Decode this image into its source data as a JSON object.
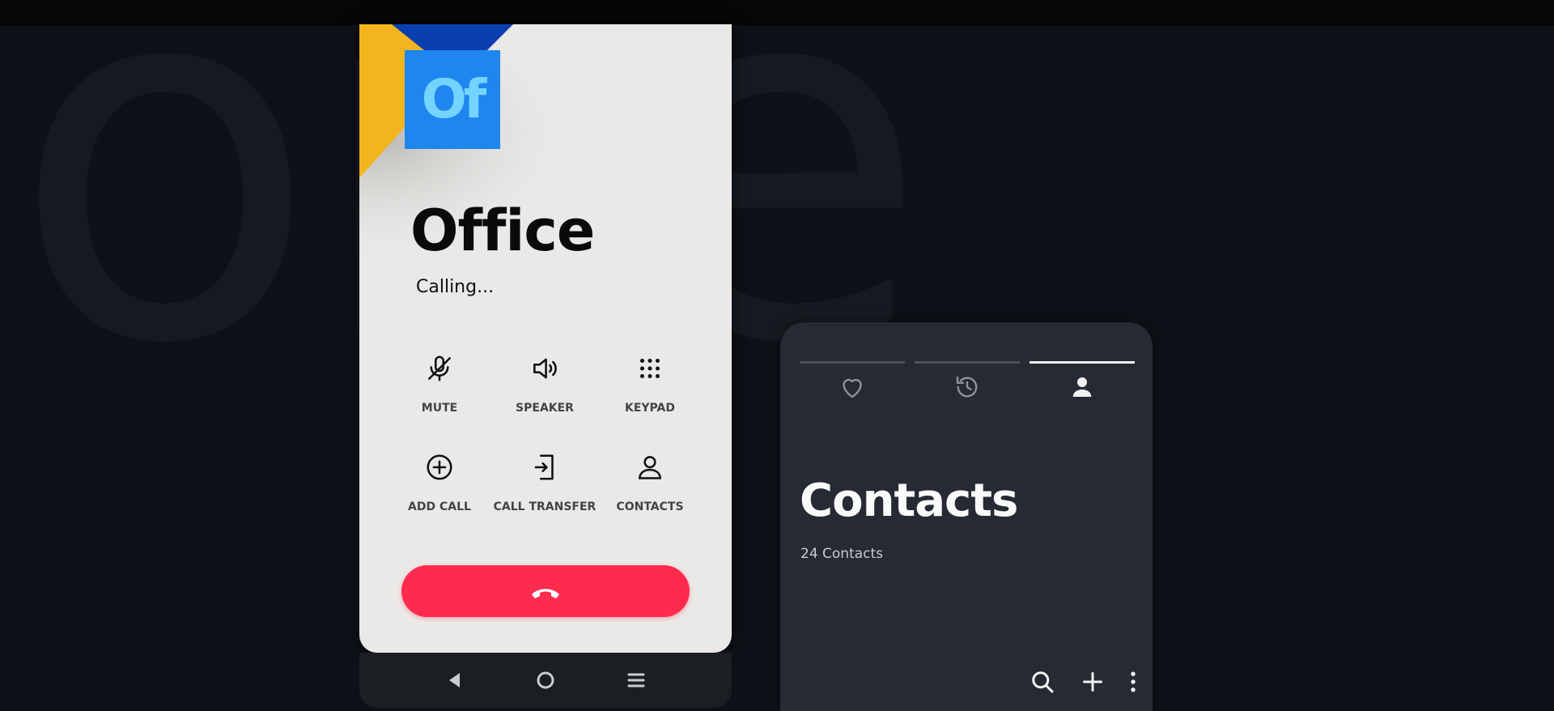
{
  "background": {
    "watermark_text": "one",
    "color": "#0e1117"
  },
  "call_screen": {
    "avatar_initials": "Of",
    "caller_name": "Office",
    "status": "Calling...",
    "actions": [
      {
        "label": "MUTE",
        "icon": "mic-off-icon"
      },
      {
        "label": "SPEAKER",
        "icon": "speaker-icon"
      },
      {
        "label": "KEYPAD",
        "icon": "keypad-icon"
      },
      {
        "label": "ADD CALL",
        "icon": "add-call-icon"
      },
      {
        "label": "CALL TRANSFER",
        "icon": "call-transfer-icon"
      },
      {
        "label": "CONTACTS",
        "icon": "contacts-icon"
      }
    ],
    "end_call_icon": "phone-hangup-icon",
    "colors": {
      "end_call": "#ff2b4f",
      "tile": "#1f86f0",
      "tile_text": "#74d4ff",
      "accent_yellow": "#f3b51e",
      "accent_blue": "#0a3fb0"
    }
  },
  "nav_bar": {
    "buttons": [
      "back-icon",
      "home-icon",
      "recents-icon"
    ]
  },
  "contacts_screen": {
    "tabs": [
      {
        "name": "favorites",
        "icon": "heart-icon",
        "active": false
      },
      {
        "name": "recents",
        "icon": "history-icon",
        "active": false
      },
      {
        "name": "contacts",
        "icon": "person-icon",
        "active": true
      }
    ],
    "title": "Contacts",
    "count": "24 Contacts",
    "toolbar": [
      "search-icon",
      "add-icon",
      "more-vert-icon"
    ],
    "colors": {
      "background": "#252a33"
    }
  }
}
